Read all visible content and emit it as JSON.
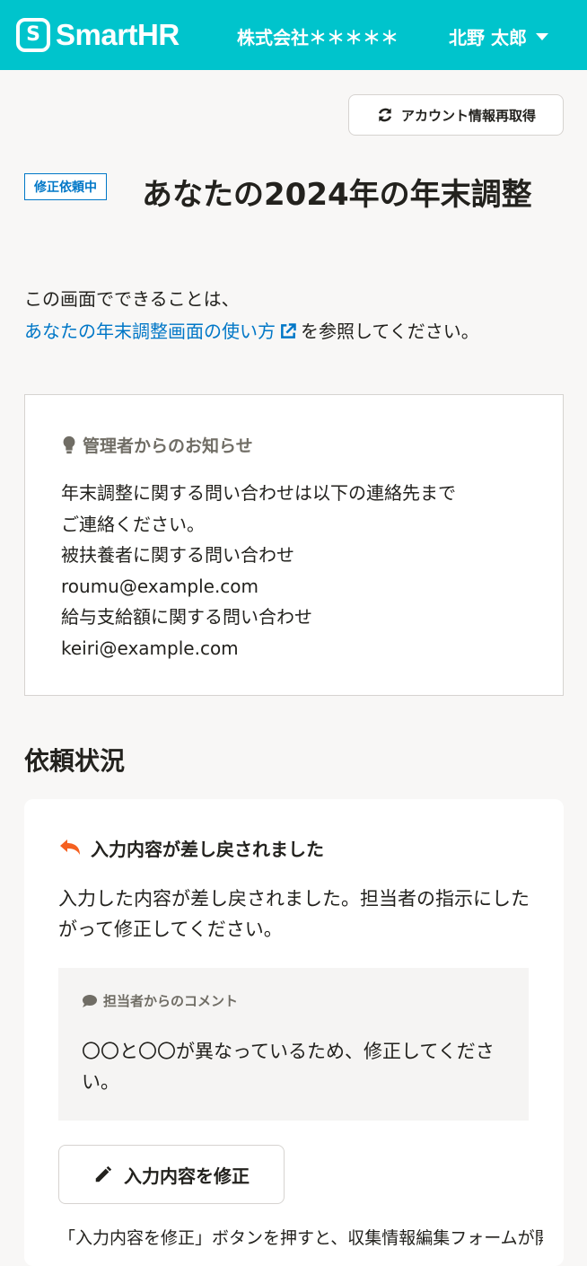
{
  "header": {
    "logo_text": "SmartHR",
    "logo_mark": "S",
    "tenant": "株式会社＊＊＊＊＊",
    "user": "北野 太郎"
  },
  "toolbar": {
    "refresh_label": "アカウント情報再取得",
    "refresh_icon": "refresh-icon"
  },
  "page": {
    "status_badge": "修正依頼中",
    "title": "あなたの2024年の年末調整",
    "intro_line1": "この画面でできることは、",
    "intro_link": "あなたの年末調整画面の使い方",
    "intro_after_link": "を参照してください。"
  },
  "notice": {
    "heading": "管理者からのお知らせ",
    "lines": [
      "年末調整に関する問い合わせは以下の連絡先まで",
      "ご連絡ください。",
      "被扶養者に関する問い合わせ",
      "roumu@example.com",
      "給与支給額に関する問い合わせ",
      "keiri@example.com"
    ]
  },
  "status_section": {
    "title": "依頼状況",
    "card_heading": "入力内容が差し戻されました",
    "card_text": "入力した内容が差し戻されました。担当者の指示にしたがって修正してください。",
    "comment_heading": "担当者からのコメント",
    "comment_text": "〇〇と〇〇が異なっているため、修正してください。",
    "fix_button": "入力内容を修正",
    "footnote": "「入力内容を修正」ボタンを押すと、収集情報編集フォームが開"
  },
  "colors": {
    "header_bg": "#00c4cc",
    "link": "#0077c7",
    "return_icon": "#f56121"
  }
}
